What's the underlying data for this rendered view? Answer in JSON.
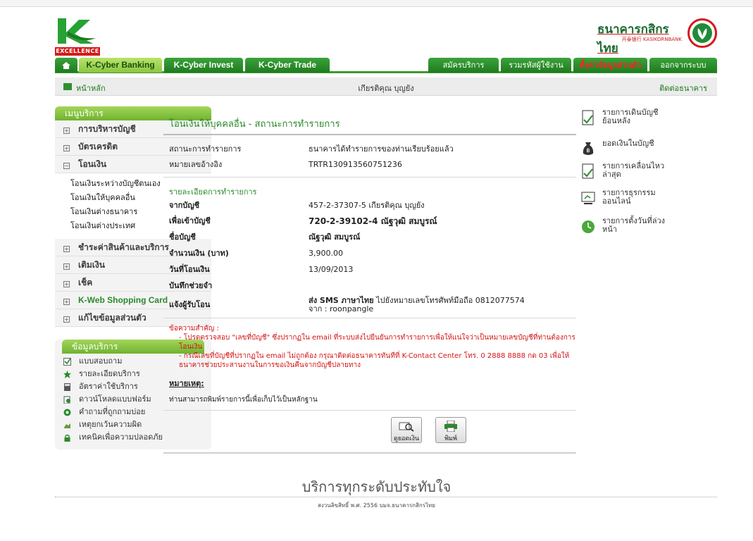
{
  "branding": {
    "k_logo_text": "EXCELLENCE",
    "bank_name_thai": "ธนาคารกสิกรไทย",
    "bank_name_eng": "开泰银行 KASIKORNBANK"
  },
  "nav": {
    "tabs": [
      {
        "label": "K-Cyber Banking"
      },
      {
        "label": "K-Cyber Invest"
      },
      {
        "label": "K-Cyber Trade"
      }
    ],
    "right_tabs": [
      {
        "label": "สมัครบริการ"
      },
      {
        "label": "รวมรหัสผู้ใช้งาน"
      },
      {
        "label": "ตั้งค่าข้อมูลส่วนตัว"
      },
      {
        "label": "ออกจากระบบ"
      }
    ],
    "home_label": "หน้าหลัก",
    "user_name": "เกียรติคุณ บุญยัง",
    "contact_label": "ติดต่อธนาคาร"
  },
  "menu": {
    "header": "เมนูบริการ",
    "items": [
      {
        "label": "การบริหารบัญชี",
        "sign": "+"
      },
      {
        "label": "บัตรเครดิต",
        "sign": "+"
      },
      {
        "label": "โอนเงิน",
        "sign": "−"
      }
    ],
    "transfer_sub": [
      {
        "label": "โอนเงินระหว่างบัญชีตนเอง"
      },
      {
        "label": "โอนเงินให้บุคคลอื่น"
      },
      {
        "label": "โอนเงินต่างธนาคาร"
      },
      {
        "label": "โอนเงินต่างประเทศ"
      }
    ],
    "items2": [
      {
        "label": "ชำระค่าสินค้าและบริการ",
        "sign": "+"
      },
      {
        "label": "เติมเงิน",
        "sign": "+"
      },
      {
        "label": "เช็ค",
        "sign": "+"
      },
      {
        "label": "K-Web Shopping Card",
        "sign": "+"
      },
      {
        "label": "แก้ไขข้อมูลส่วนตัว",
        "sign": "+"
      }
    ]
  },
  "service_info": {
    "header": "ข้อมูลบริการ",
    "items": [
      {
        "label": "แบบสอบถาม"
      },
      {
        "label": "รายละเอียดบริการ"
      },
      {
        "label": "อัตราค่าใช้บริการ"
      },
      {
        "label": "ดาวน์โหลดแบบฟอร์ม"
      },
      {
        "label": "คำถามที่ถูกถามบ่อย"
      },
      {
        "label": "เหตุยกเว้นความผิด"
      },
      {
        "label": "เทคนิคเพื่อความปลอดภัย"
      }
    ]
  },
  "main": {
    "title": "โอนเงินให้บุคคลอื่น - สถานะการทำรายการ",
    "status_label": "สถานะการทำรายการ",
    "status_value": "ธนาคารได้ทำรายการของท่านเรียบร้อยแล้ว",
    "ref_label": "หมายเลขอ้างอิง",
    "ref_value": "TRTR130913560751236",
    "detail_header": "รายละเอียดการทำรายการ",
    "details": [
      {
        "label": "จากบัญชี",
        "value": "457-2-37307-5 เกียรติคุณ บุญยัง"
      },
      {
        "label": "เพื่อเข้าบัญชี",
        "value": "720-2-39102-4 ณัฐวุฒิ สมบูรณ์"
      },
      {
        "label": "ชื่อบัญชี",
        "value": "ณัฐวุฒิ สมบูรณ์"
      },
      {
        "label": "จำนวนเงิน (บาท)",
        "value": "3,900.00"
      },
      {
        "label": "วันที่โอนเงิน",
        "value": "13/09/2013"
      },
      {
        "label": "บันทึกช่วยจำ",
        "value": ""
      }
    ],
    "notify_label": "แจ้งผู้รับโอน",
    "notify_prefix": "ส่ง SMS ภาษาไทย",
    "notify_rest": " ไปยังหมายเลขโทรศัพท์มือถือ 0812077574",
    "notify_from": "จาก : roonpangle",
    "important_title": "ข้อความสำคัญ :",
    "important_1": "- โปรดตรวจสอบ \"เลขที่บัญชี\" ซึ่งปรากฏใน email ที่ระบบส่งไปยืนยันการทำรายการเพื่อให้แน่ใจว่าเป็นหมายเลขบัญชีที่ท่านต้องการโอนเงิน",
    "important_2": "- กรณีเลขที่บัญชีที่ปรากฏใน email ไม่ถูกต้อง กรุณาติดต่อธนาคารทันทีที่ K-Contact Center โทร. 0 2888 8888 กด 03 เพื่อให้ธนาคารช่วยประสานงานในการขอเงินคืนจากบัญชีปลายทาง",
    "remark_title": "หมายเหตุ:",
    "remark_text": "ท่านสามารถพิมพ์รายการนี้เพื่อเก็บไว้เป็นหลักฐาน",
    "btn_balance": "ดูยอดเงิน",
    "btn_print": "พิมพ์"
  },
  "quick": [
    {
      "label": "รายการเดินบัญชีย้อนหลัง"
    },
    {
      "label": "ยอดเงินในบัญชี"
    },
    {
      "label": "รายการเคลื่อนไหวล่าสุด"
    },
    {
      "label": "รายการธุรกรรมออนไลน์"
    },
    {
      "label": "รายการตั้งวันที่ล่วงหน้า"
    }
  ],
  "footer": {
    "slogan": "บริการทุกระดับประทับใจ",
    "copyright": "สงวนลิขสิทธิ์ พ.ศ. 2556 บมจ.ธนาคารกสิกรไทย"
  },
  "colors": {
    "brand_green": "#2a8a2a",
    "alert_red": "#d41414"
  }
}
